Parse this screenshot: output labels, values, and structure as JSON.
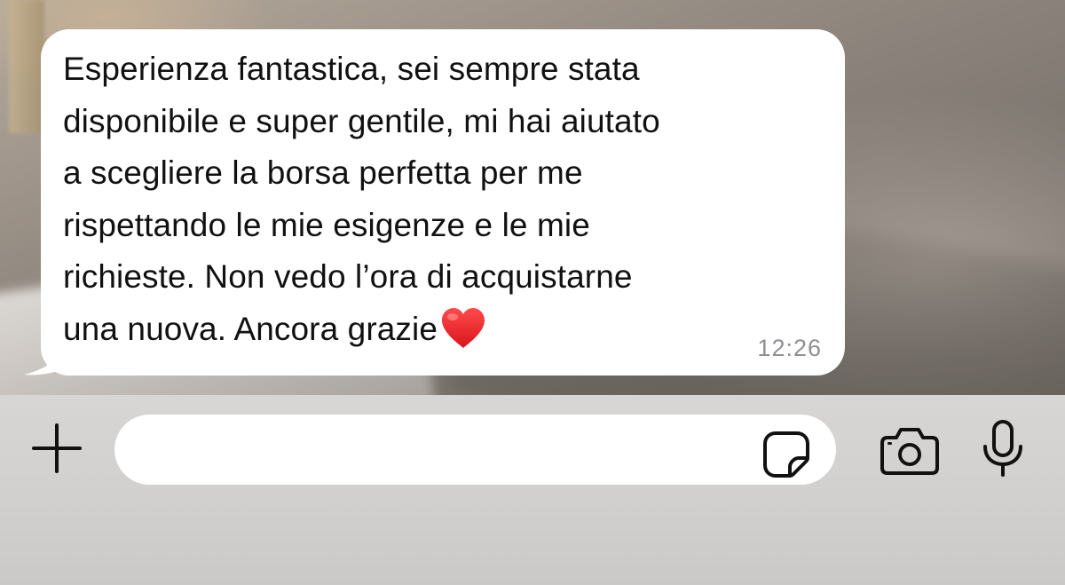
{
  "chat": {
    "message": {
      "text": "Esperienza fantastica, sei sempre stata\ndisponibile e super gentile, mi hai aiutato\na scegliere la borsa perfetta per me\nrispettando le mie esigenze e le mie\nrichieste. Non vedo l’ora di acquistarne\nuna nuova. Ancora grazie",
      "emoji": "red-heart-icon",
      "time": "12:26"
    }
  },
  "input_bar": {
    "message_value": "",
    "message_placeholder": "",
    "icons": {
      "attach": "plus-icon",
      "sticker": "sticker-icon",
      "camera": "camera-icon",
      "microphone": "microphone-icon"
    }
  },
  "colors": {
    "bubble": "#ffffff",
    "timestamp": "#8e8e93",
    "heart": "#e8232b",
    "input_bar": "#d5d3d1",
    "icon": "#111111"
  }
}
